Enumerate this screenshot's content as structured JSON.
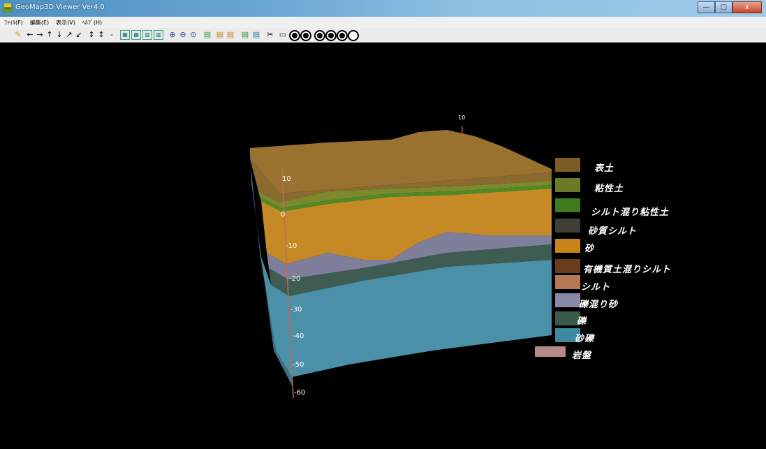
{
  "window": {
    "title": "GeoMap3D Viewer Ver4.0",
    "controls": {
      "minimize": "—",
      "maximize": "□",
      "close": "x"
    }
  },
  "menu": [
    "ﾌｧｲﾙ(F)",
    "編集(E)",
    "表示(V)",
    "ﾍﾙﾌﾟ(H)"
  ],
  "toolbar": {
    "icons": [
      "wand-icon",
      "arrow-left-icon",
      "arrow-right-icon",
      "arrow-up-icon",
      "arrow-down-icon",
      "arrow-up-right-icon",
      "arrow-down-left-icon",
      "arrow-up-down-icon",
      "arrow-up-down-icon",
      "minus-icon",
      "frame-icon",
      "frame-icon",
      "frame-icon",
      "frame-icon",
      "zoom-in-icon",
      "zoom-out-icon",
      "zoom-fit-icon",
      "layer-icon",
      "layer-icon",
      "layer-icon",
      "layer-icon",
      "layer-icon",
      "scissors-icon",
      "rect-icon",
      "circle-icon",
      "circle-icon",
      "circle-icon",
      "circle-icon",
      "circle-icon",
      "circle-x-icon"
    ]
  },
  "viewport": {
    "depth_axis": [
      "10",
      "0",
      "-10",
      "-20",
      "-30",
      "-40",
      "-50",
      "-60"
    ],
    "top_axis_label": "10",
    "legend": [
      {
        "label": "表土",
        "color": "#7d5d26"
      },
      {
        "label": "粘性土",
        "color": "#6b7a24"
      },
      {
        "label": "シルト混り粘性土",
        "color": "#3f7a1f"
      },
      {
        "label": "砂質シルト",
        "color": "#3d3f35"
      },
      {
        "label": "砂",
        "color": "#c88417"
      },
      {
        "label": "有機質土混りシルト",
        "color": "#6b3c1c"
      },
      {
        "label": "シルト",
        "color": "#b57a55"
      },
      {
        "label": "礫混り砂",
        "color": "#8a8aa8"
      },
      {
        "label": "礫",
        "color": "#3c5a4b"
      },
      {
        "label": "砂礫",
        "color": "#3b8aa0"
      },
      {
        "label": "岩盤",
        "color": "#b58a85"
      }
    ],
    "block_colors": {
      "top_surface": "#9a7230",
      "topsoil_front": "#8a6a2f",
      "clay_band": "#7d8a2c",
      "silty_clay_band": "#4e8a25",
      "sand": "#c58a26",
      "gravelly_sand": "#7f7f9b",
      "gravel": "#3e5c52",
      "sandy_gravel": "#4a90a8"
    }
  }
}
